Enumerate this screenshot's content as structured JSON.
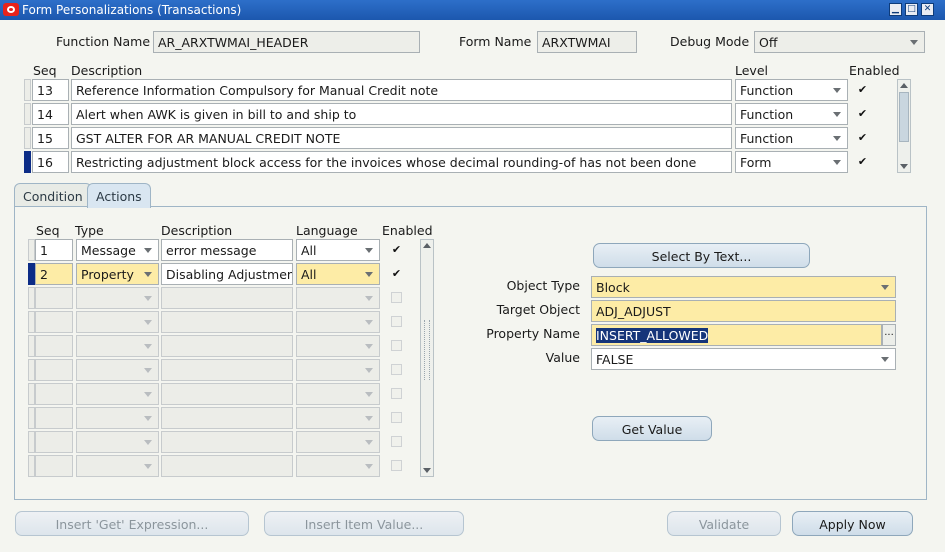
{
  "window": {
    "title": "Form Personalizations (Transactions)"
  },
  "header": {
    "function_name_label": "Function Name",
    "function_name_value": "AR_ARXTWMAI_HEADER",
    "form_name_label": "Form Name",
    "form_name_value": "ARXTWMAI",
    "debug_mode_label": "Debug Mode",
    "debug_mode_value": "Off"
  },
  "rules": {
    "columns": {
      "seq": "Seq",
      "description": "Description",
      "level": "Level",
      "enabled": "Enabled"
    },
    "rows": [
      {
        "seq": "13",
        "description": "Reference Information Compulsory for Manual Credit note",
        "level": "Function",
        "enabled": "✔"
      },
      {
        "seq": "14",
        "description": "Alert when AWK is given in bill to and ship to",
        "level": "Function",
        "enabled": "✔"
      },
      {
        "seq": "15",
        "description": "GST ALTER FOR AR MANUAL CREDIT NOTE",
        "level": "Function",
        "enabled": "✔"
      },
      {
        "seq": "16",
        "description": "Restricting adjustment block access for the invoices whose decimal rounding-of has not been done",
        "level": "Form",
        "enabled": "✔"
      }
    ]
  },
  "tabs": {
    "condition": "Condition",
    "actions": "Actions"
  },
  "actions": {
    "columns": {
      "seq": "Seq",
      "type": "Type",
      "description": "Description",
      "language": "Language",
      "enabled": "Enabled"
    },
    "rows": [
      {
        "seq": "1",
        "type": "Message",
        "description": "error message",
        "language": "All",
        "enabled": "✔"
      },
      {
        "seq": "2",
        "type": "Property",
        "description": "Disabling Adjustment I",
        "language": "All",
        "enabled": "✔"
      }
    ]
  },
  "details": {
    "select_by_text_button": "Select By Text...",
    "object_type_label": "Object Type",
    "object_type_value": "Block",
    "target_object_label": "Target Object",
    "target_object_value": "ADJ_ADJUST",
    "property_name_label": "Property Name",
    "property_name_value": "INSERT_ALLOWED",
    "lov_button": "...",
    "value_label": "Value",
    "value_value": "FALSE",
    "get_value_button": "Get Value"
  },
  "footer": {
    "insert_get_expression": "Insert 'Get' Expression...",
    "insert_item_value": "Insert Item Value...",
    "validate": "Validate",
    "apply_now": "Apply Now"
  },
  "colors": {
    "titlebar": "#1c57ae",
    "required_field": "#fdeca6",
    "current_record": "#0c2c86"
  }
}
